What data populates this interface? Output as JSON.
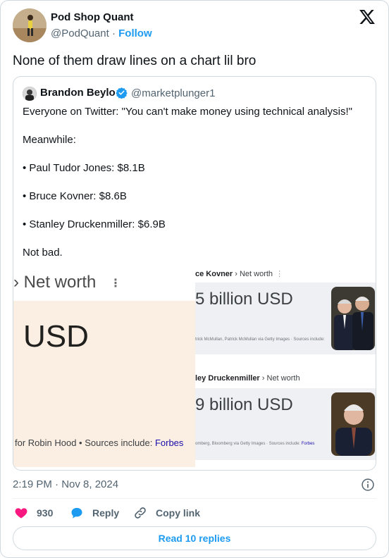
{
  "author": {
    "name": "Pod Shop Quant",
    "handle": "@PodQuant",
    "separator": "·",
    "follow_label": "Follow"
  },
  "tweet": {
    "text": "None of them draw lines on a chart lil bro",
    "timestamp": "2:19 PM · Nov 8, 2024"
  },
  "quoted": {
    "name": "Brandon Beylo",
    "handle": "@marketplunger1",
    "lines": [
      "Everyone on Twitter: \"You can't make money using technical analysis!\"",
      "Meanwhile:",
      "• Paul Tudor Jones: $8.1B",
      "• Bruce Kovner: $8.6B",
      "• Stanley Druckenmiller: $6.9B",
      "Not bad."
    ],
    "image_left": {
      "title": "› Net worth",
      "dots": "⋮",
      "value": "USD",
      "source_prefix": "for Robin Hood • Sources include: ",
      "source_link": "Forbes"
    },
    "image_right": {
      "panel1_name": "ce Kovner",
      "panel1_suffix": " › Net worth",
      "panel1_value": "5 billion USD",
      "panel1_credit": "trick McMullan, Patrick McMullan via Getty Images · Sources include:",
      "panel2_name": "ley Druckenmiller",
      "panel2_suffix": " › Net worth",
      "panel2_value": "9 billion USD",
      "panel2_credit": "omberg, Bloomberg via Getty Images · Sources include: ",
      "panel2_link": "Forbes",
      "dots": "⋮"
    }
  },
  "actions": {
    "likes": "930",
    "reply_label": "Reply",
    "copy_label": "Copy link"
  },
  "read_replies": "Read 10 replies",
  "colors": {
    "accent": "#1d9bf0",
    "like": "#f91880",
    "muted": "#536471",
    "border": "#cfd9de"
  },
  "icons": [
    "x-logo-icon",
    "verified-badge-icon",
    "info-icon",
    "heart-icon",
    "reply-icon",
    "link-icon"
  ]
}
